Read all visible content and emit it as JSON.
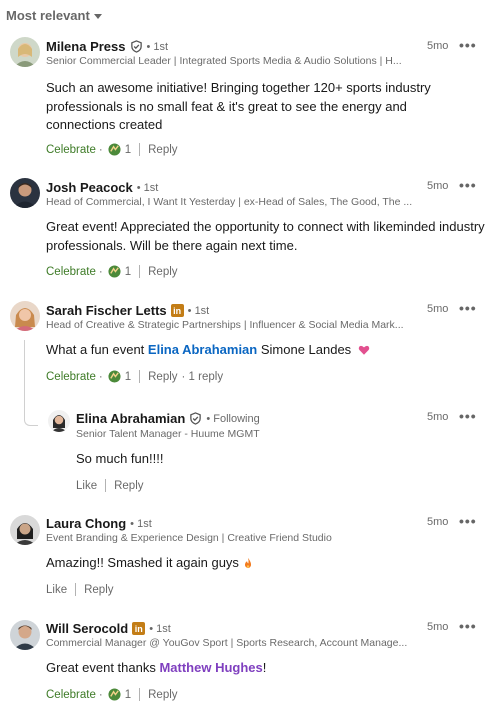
{
  "sort": {
    "label": "Most relevant"
  },
  "actions_common": {
    "more": "•••",
    "separator": "·"
  },
  "comments": [
    {
      "name": "Milena Press",
      "degree": "• 1st",
      "headline": "Senior Commercial Leader | Integrated Sports Media & Audio Solutions | H...",
      "time": "5mo",
      "text": "Such an awesome initiative! Bringing together 120+ sports industry professionals is no small feat & it's great to see the energy and connections created",
      "reaction_label": "Celebrate",
      "reaction_count": "1",
      "reply": "Reply"
    },
    {
      "name": "Josh Peacock",
      "degree": "• 1st",
      "headline": "Head of Commercial, I Want It Yesterday | ex-Head of Sales, The Good, The ...",
      "time": "5mo",
      "text": "Great event! Appreciated the opportunity to connect with likeminded industry professionals. Will be there again next time.",
      "reaction_label": "Celebrate",
      "reaction_count": "1",
      "reply": "Reply"
    },
    {
      "name": "Sarah Fischer Letts",
      "degree": "• 1st",
      "headline": "Head of Creative & Strategic Partnerships | Influencer & Social Media Mark...",
      "time": "5mo",
      "text_before": "What a fun event ",
      "mention": "Elina Abrahamian",
      "text_after": " Simone Landes ",
      "reaction_label": "Celebrate",
      "reaction_count": "1",
      "reply": "Reply",
      "reply_count": "· 1 reply"
    },
    {
      "name": "Elina Abrahamian",
      "degree": "• Following",
      "headline": "Senior Talent Manager - Huume MGMT",
      "time": "5mo",
      "text": "So much fun!!!!",
      "like": "Like",
      "reply": "Reply"
    },
    {
      "name": "Laura Chong",
      "degree": "• 1st",
      "headline": "Event Branding & Experience Design | Creative Friend Studio",
      "time": "5mo",
      "text": "Amazing!! Smashed it again guys",
      "like": "Like",
      "reply": "Reply"
    },
    {
      "name": "Will Serocold",
      "degree": "• 1st",
      "headline": "Commercial Manager @ YouGov Sport | Sports Research, Account Manage...",
      "time": "5mo",
      "text_before": "Great event thanks ",
      "mention": "Matthew Hughes",
      "text_after": "!",
      "reaction_label": "Celebrate",
      "reaction_count": "1",
      "reply": "Reply"
    }
  ],
  "colors": {
    "mention_blue": "#0a66c2",
    "mention_purple": "#7f3fbf",
    "celebrate_green": "#3e7b27",
    "premium_badge": "#c37d16"
  }
}
